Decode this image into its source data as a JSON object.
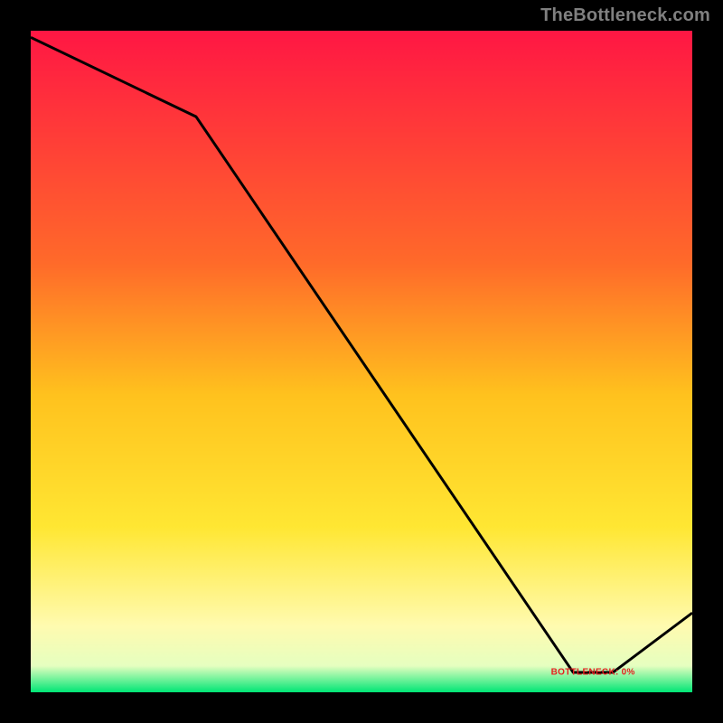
{
  "watermark": "TheBottleneck.com",
  "chart_data": {
    "type": "line",
    "title": "",
    "xlabel": "",
    "ylabel": "",
    "xlim": [
      0,
      100
    ],
    "ylim": [
      0,
      100
    ],
    "x": [
      0,
      25,
      82,
      88,
      100
    ],
    "values": [
      99,
      87,
      3,
      3,
      12
    ],
    "annotation": {
      "text": "BOTTLENECK: 0%",
      "x": 85,
      "y": 3
    },
    "gradient_stops": [
      {
        "pos": 0.0,
        "color": "#ff1744"
      },
      {
        "pos": 0.35,
        "color": "#ff6a2a"
      },
      {
        "pos": 0.55,
        "color": "#ffc21e"
      },
      {
        "pos": 0.75,
        "color": "#ffe733"
      },
      {
        "pos": 0.9,
        "color": "#fffbb0"
      },
      {
        "pos": 0.96,
        "color": "#e6ffc0"
      },
      {
        "pos": 1.0,
        "color": "#00e676"
      }
    ],
    "line_color": "#000000"
  }
}
